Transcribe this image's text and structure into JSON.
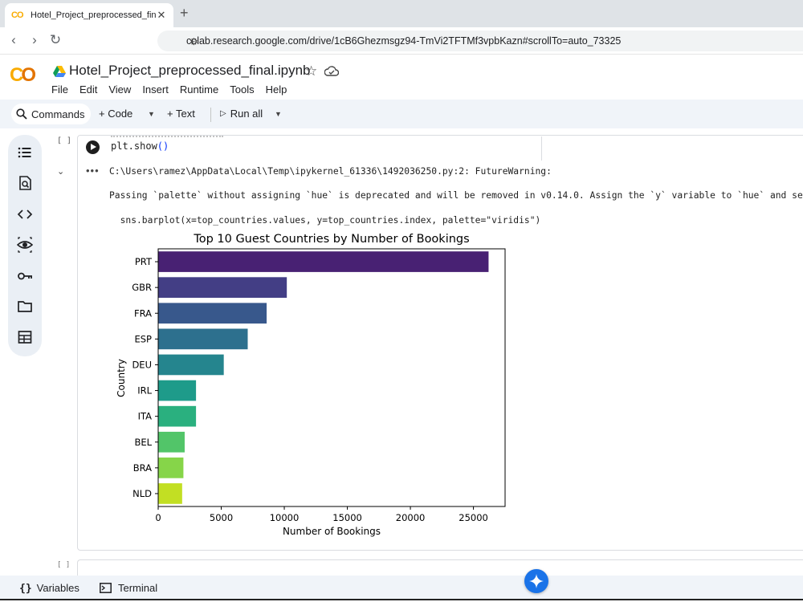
{
  "browser": {
    "tab_title": "Hotel_Project_preprocessed_final.ipynb",
    "tab_close": "✕",
    "new_tab": "+",
    "url": "colab.research.google.com/drive/1cB6Ghezmsgz94-TmVi2TFTMf3vpbKazn#scrollTo=auto_73325"
  },
  "colab": {
    "logo": "CO",
    "notebook_title": "Hotel_Project_preprocessed_final.ipynb",
    "menu": [
      "File",
      "Edit",
      "View",
      "Insert",
      "Runtime",
      "Tools",
      "Help"
    ],
    "toolbar": {
      "commands": "Commands",
      "code": "+ Code",
      "text": "+ Text",
      "run_all": "Run all"
    },
    "rail_icons": [
      "toc-icon",
      "find-icon",
      "code-snippets-icon",
      "variables-inspector-icon",
      "secrets-key-icon",
      "files-folder-icon",
      "data-table-icon"
    ]
  },
  "cell": {
    "execution_count": "[ ]",
    "code": "plt.show",
    "code_parens": "()",
    "output_lines": [
      "C:\\Users\\ramez\\AppData\\Local\\Temp\\ipykernel_61336\\1492036250.py:2: FutureWarning:",
      "Passing `palette` without assigning `hue` is deprecated and will be removed in v0.14.0. Assign the `y` variable to `hue` and set",
      "  sns.barplot(x=top_countries.values, y=top_countries.index, palette=\"viridis\")"
    ],
    "next_execution_count": "[ ]"
  },
  "chart_data": {
    "type": "bar",
    "orientation": "horizontal",
    "title": "Top 10 Guest Countries by Number of Bookings",
    "xlabel": "Number of Bookings",
    "ylabel": "Country",
    "categories": [
      "PRT",
      "GBR",
      "FRA",
      "ESP",
      "DEU",
      "IRL",
      "ITA",
      "BEL",
      "BRA",
      "NLD"
    ],
    "values": [
      26200,
      10200,
      8600,
      7100,
      5200,
      3000,
      3000,
      2100,
      2000,
      1900
    ],
    "colors": [
      "#482173",
      "#433e85",
      "#38588c",
      "#2d708e",
      "#25858e",
      "#1e9b8a",
      "#2ab07f",
      "#52c569",
      "#86d549",
      "#c2df23"
    ],
    "xticks": [
      0,
      5000,
      10000,
      15000,
      20000,
      25000
    ],
    "xlim": [
      0,
      27510
    ],
    "grid": false,
    "legend": "none"
  },
  "statusbar": {
    "variables": "Variables",
    "terminal": "Terminal"
  }
}
